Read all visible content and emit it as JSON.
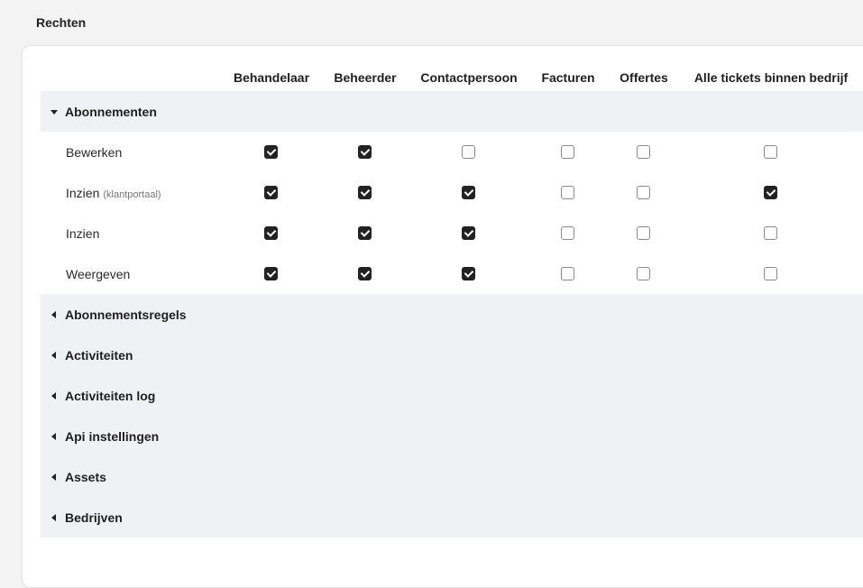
{
  "page": {
    "title": "Rechten"
  },
  "columns": [
    "Behandelaar",
    "Beheerder",
    "Contactpersoon",
    "Facturen",
    "Offertes",
    "Alle tickets binnen bedrijf"
  ],
  "expanded_group": {
    "label": "Abonnementen",
    "expanded": true,
    "rows": [
      {
        "label": "Bewerken",
        "sub": "",
        "checks": [
          true,
          true,
          false,
          false,
          false,
          false
        ]
      },
      {
        "label": "Inzien",
        "sub": "(klantportaal)",
        "checks": [
          true,
          true,
          true,
          false,
          false,
          true
        ]
      },
      {
        "label": "Inzien",
        "sub": "",
        "checks": [
          true,
          true,
          true,
          false,
          false,
          false
        ]
      },
      {
        "label": "Weergeven",
        "sub": "",
        "checks": [
          true,
          true,
          true,
          false,
          false,
          false
        ]
      }
    ]
  },
  "collapsed_groups": [
    {
      "label": "Abonnementsregels"
    },
    {
      "label": "Activiteiten"
    },
    {
      "label": "Activiteiten log"
    },
    {
      "label": "Api instellingen"
    },
    {
      "label": "Assets"
    },
    {
      "label": "Bedrijven"
    }
  ]
}
